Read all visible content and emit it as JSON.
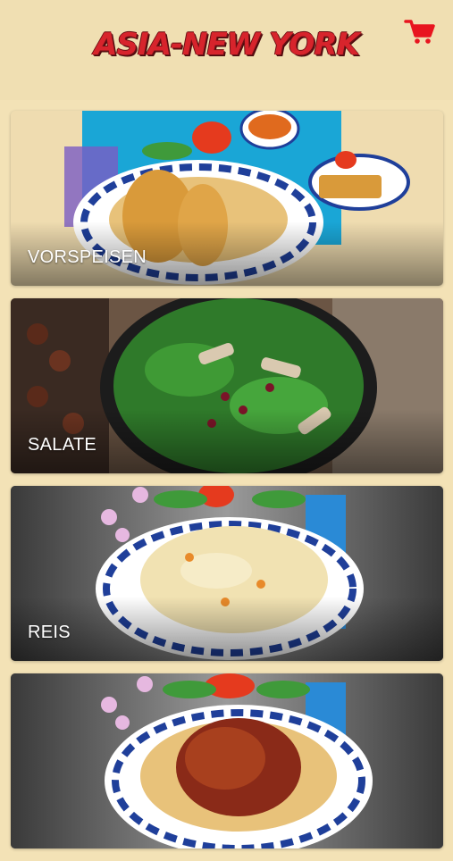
{
  "header": {
    "brand": "ASIA-NEW YORK",
    "cart_icon": "shopping-cart-icon",
    "brand_color": "#d7242c"
  },
  "categories": [
    {
      "label": "VORSPEISEN"
    },
    {
      "label": "SALATE"
    },
    {
      "label": "REIS"
    },
    {
      "label": ""
    }
  ],
  "colors": {
    "background": "#f3e2b6",
    "accent": "#e8151f"
  }
}
